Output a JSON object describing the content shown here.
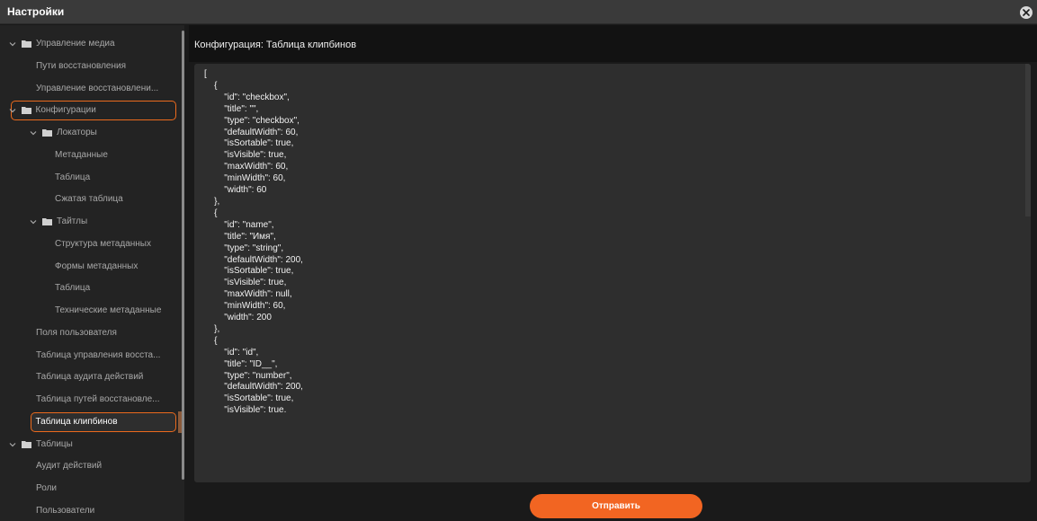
{
  "window": {
    "title": "Настройки",
    "close_icon": "close-icon"
  },
  "sidebar": {
    "items": [
      {
        "label": "Управление медиа",
        "type": "folder",
        "level": 0,
        "expanded": true
      },
      {
        "label": "Пути восстановления",
        "type": "leaf",
        "level": 1
      },
      {
        "label": "Управление восстановлени...",
        "type": "leaf",
        "level": 1
      },
      {
        "label": "Конфигурации",
        "type": "folder",
        "level": 0,
        "expanded": true,
        "highlighted": true
      },
      {
        "label": "Локаторы",
        "type": "folder",
        "level": 1,
        "expanded": true
      },
      {
        "label": "Метаданные",
        "type": "leaf",
        "level": 2
      },
      {
        "label": "Таблица",
        "type": "leaf",
        "level": 2
      },
      {
        "label": "Сжатая таблица",
        "type": "leaf",
        "level": 2
      },
      {
        "label": "Тайтлы",
        "type": "folder",
        "level": 1,
        "expanded": true
      },
      {
        "label": "Структура метаданных",
        "type": "leaf",
        "level": 2
      },
      {
        "label": "Формы метаданных",
        "type": "leaf",
        "level": 2
      },
      {
        "label": "Таблица",
        "type": "leaf",
        "level": 2
      },
      {
        "label": "Технические метаданные",
        "type": "leaf",
        "level": 2
      },
      {
        "label": "Поля пользователя",
        "type": "leaf",
        "level": 1
      },
      {
        "label": "Таблица управления восста...",
        "type": "leaf",
        "level": 1
      },
      {
        "label": "Таблица аудита действий",
        "type": "leaf",
        "level": 1
      },
      {
        "label": "Таблица путей восстановле...",
        "type": "leaf",
        "level": 1
      },
      {
        "label": "Таблица клипбинов",
        "type": "leaf",
        "level": 1,
        "selected": true,
        "highlighted": true
      },
      {
        "label": "Таблицы",
        "type": "folder",
        "level": 0,
        "expanded": true
      },
      {
        "label": "Аудит действий",
        "type": "leaf",
        "level": 1
      },
      {
        "label": "Роли",
        "type": "leaf",
        "level": 1
      },
      {
        "label": "Пользователи",
        "type": "leaf",
        "level": 1
      }
    ]
  },
  "main": {
    "header": "Конфигурация: Таблица клипбинов",
    "editor_content": "[\n    {\n        \"id\": \"checkbox\",\n        \"title\": \"\",\n        \"type\": \"checkbox\",\n        \"defaultWidth\": 60,\n        \"isSortable\": true,\n        \"isVisible\": true,\n        \"maxWidth\": 60,\n        \"minWidth\": 60,\n        \"width\": 60\n    },\n    {\n        \"id\": \"name\",\n        \"title\": \"Имя\",\n        \"type\": \"string\",\n        \"defaultWidth\": 200,\n        \"isSortable\": true,\n        \"isVisible\": true,\n        \"maxWidth\": null,\n        \"minWidth\": 60,\n        \"width\": 200\n    },\n    {\n        \"id\": \"id\",\n        \"title\": \"ID__\",\n        \"type\": \"number\",\n        \"defaultWidth\": 200,\n        \"isSortable\": true,\n        \"isVisible\": true.",
    "submit_label": "Отправить"
  },
  "colors": {
    "accent": "#f26522",
    "highlight_outline": "#ec6a1d",
    "background": "#1a1a1a",
    "sidebar": "#232323",
    "editor": "#2e2e2e"
  }
}
